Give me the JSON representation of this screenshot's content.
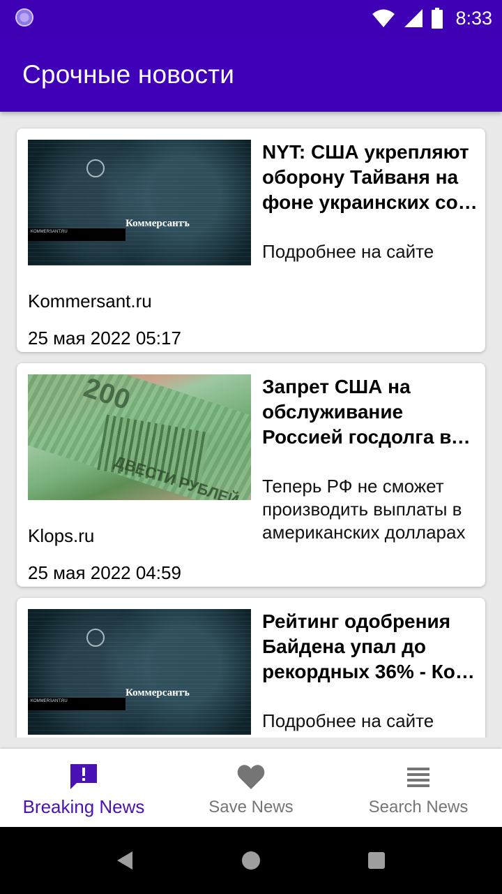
{
  "status_bar": {
    "time": "8:33",
    "icons": [
      "app-notification-icon",
      "wifi-icon",
      "signal-icon",
      "battery-icon"
    ]
  },
  "app_bar": {
    "title": "Срочные новости"
  },
  "articles": [
    {
      "title": "NYT: США укрепляют обороне Тайваня на фоне украинских со…",
      "title_lines": [
        "NYT: США укрепляют",
        "оборону Тайваня на",
        "фоне украинских со…"
      ],
      "description": "Подробнее на сайте",
      "source": "Kommersant.ru",
      "date": "25 мая 2022 05:17",
      "thumbnail": {
        "logo_text": "Коммерсантъ",
        "caption": "KOMMERSANT.RU"
      }
    },
    {
      "title_lines": [
        "Запрет США на",
        "обслуживание",
        "Россией госдолга вс…"
      ],
      "description": "Теперь РФ не сможет производить выплаты в американских долларах",
      "source": "Klops.ru",
      "date": "25 мая 2022 04:59",
      "thumbnail": {
        "denomination": "200",
        "banknote_text": "ДВЕСТИ РУБЛЕЙ"
      }
    },
    {
      "title_lines": [
        "Рейтинг одобрения",
        "Байдена упал до",
        "рекордных 36% - Ко…"
      ],
      "description": "Подробнее на сайте",
      "thumbnail": {
        "logo_text": "Коммерсантъ",
        "caption": "KOMMERSANT.RU"
      }
    }
  ],
  "bottom_nav": {
    "items": [
      {
        "label": "Breaking News",
        "icon": "alert-message-icon",
        "active": true
      },
      {
        "label": "Save News",
        "icon": "heart-icon",
        "active": false
      },
      {
        "label": "Search News",
        "icon": "list-icon",
        "active": false
      }
    ]
  },
  "colors": {
    "primary": "#4000b8",
    "status_bar": "#3f00b5",
    "active_nav": "#4a12b5",
    "inactive_nav": "#757575"
  }
}
